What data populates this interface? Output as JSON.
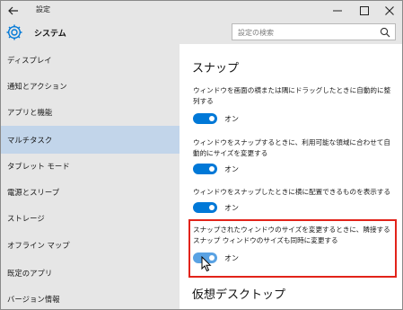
{
  "window": {
    "title": "設定"
  },
  "header": {
    "section_title": "システム",
    "search_placeholder": "設定の検索"
  },
  "sidebar": {
    "items": [
      {
        "label": "ディスプレイ",
        "selected": false
      },
      {
        "label": "通知とアクション",
        "selected": false
      },
      {
        "label": "アプリと機能",
        "selected": false
      },
      {
        "label": "マルチタスク",
        "selected": true
      },
      {
        "label": "タブレット モード",
        "selected": false
      },
      {
        "label": "電源とスリープ",
        "selected": false
      },
      {
        "label": "ストレージ",
        "selected": false
      },
      {
        "label": "オフライン マップ",
        "selected": false
      },
      {
        "label": "既定のアプリ",
        "selected": false
      },
      {
        "label": "バージョン情報",
        "selected": false
      }
    ]
  },
  "content": {
    "snap_title": "スナップ",
    "settings": [
      {
        "text": "ウィンドウを画面の横または隅にドラッグしたときに自動的に整列する",
        "state": "オン"
      },
      {
        "text": "ウィンドウをスナップするときに、利用可能な領域に合わせて自動的にサイズを変更する",
        "state": "オン"
      },
      {
        "text": "ウィンドウをスナップしたときに横に配置できるものを表示する",
        "state": "オン"
      },
      {
        "text": "スナップされたウィンドウのサイズを変更するときに、隣接するスナップ ウィンドウのサイズも同時に変更する",
        "state": "オン"
      }
    ],
    "virtual_desktop_title": "仮想デスクトップ"
  },
  "colors": {
    "accent": "#0078d7",
    "highlight": "#e2231a",
    "selected_bg": "#c2d5ea",
    "sidebar_bg": "#e6e6e6"
  }
}
